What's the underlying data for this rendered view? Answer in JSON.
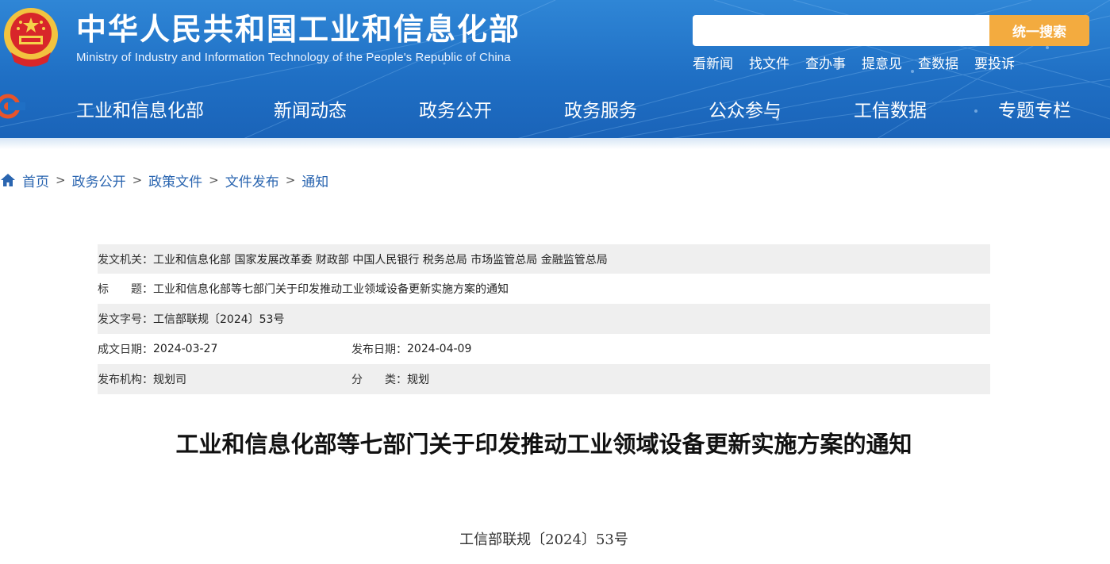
{
  "header": {
    "site_title": "中华人民共和国工业和信息化部",
    "site_subtitle": "Ministry of Industry and Information Technology of the People's Republic of China",
    "search": {
      "placeholder": "",
      "button_label": "统一搜索"
    },
    "quick_links": [
      "看新闻",
      "找文件",
      "查办事",
      "提意见",
      "查数据",
      "要投诉"
    ],
    "colors": {
      "header_blue": "#2070c6",
      "search_button": "#f3ab3f"
    }
  },
  "nav": {
    "items": [
      "工业和信息化部",
      "新闻动态",
      "政务公开",
      "政务服务",
      "公众参与",
      "工信数据",
      "专题专栏"
    ]
  },
  "breadcrumb": {
    "items": [
      "首页",
      "政务公开",
      "政策文件",
      "文件发布",
      "通知"
    ],
    "separator": ">"
  },
  "info": {
    "issuer_label": "发文机关：",
    "issuer": "工业和信息化部 国家发展改革委 财政部 中国人民银行 税务总局 市场监管总局 金融监管总局",
    "title_label": "标　　题：",
    "title": "工业和信息化部等七部门关于印发推动工业领域设备更新实施方案的通知",
    "doc_no_label": "发文字号：",
    "doc_no": "工信部联规〔2024〕53号",
    "written_date_label": "成文日期：",
    "written_date": "2024-03-27",
    "publish_date_label": "发布日期：",
    "publish_date": "2024-04-09",
    "publisher_label": "发布机构：",
    "publisher": "规划司",
    "category_label": "分　　类：",
    "category": "规划"
  },
  "article": {
    "title": "工业和信息化部等七部门关于印发推动工业领域设备更新实施方案的通知",
    "doc_no": "工信部联规〔2024〕53号"
  }
}
